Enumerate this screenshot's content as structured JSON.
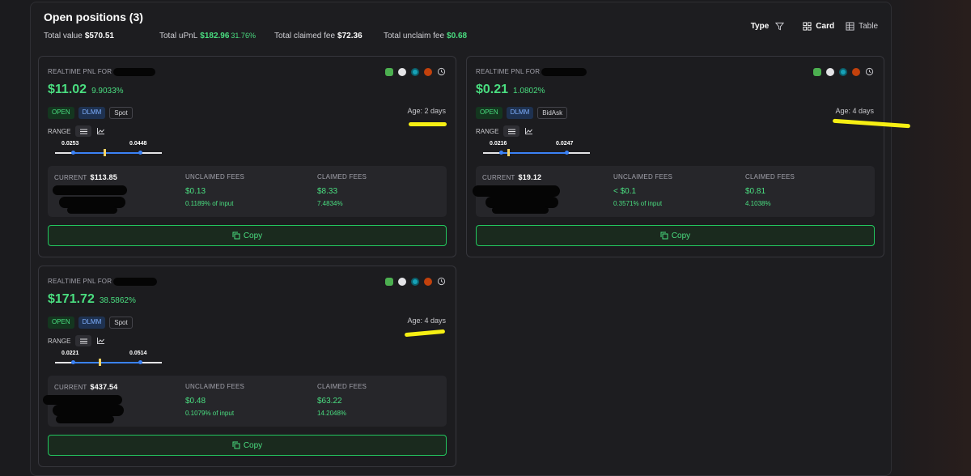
{
  "header": {
    "title": "Open positions (3)",
    "stats": {
      "total_value_label": "Total value",
      "total_value": "$570.51",
      "total_upnl_label": "Total uPnL",
      "total_upnl": "$182.96",
      "total_upnl_pct": "31.76%",
      "total_claimed_label": "Total claimed fee",
      "total_claimed": "$72.36",
      "total_unclaim_label": "Total unclaim fee",
      "total_unclaim": "$0.68"
    },
    "viewbar": {
      "type_label": "Type",
      "card_label": "Card",
      "table_label": "Table"
    }
  },
  "cards": [
    {
      "head": "REALTIME PNL FOR",
      "pnl_value": "$11.02",
      "pnl_pct": "9.9033%",
      "status": "OPEN",
      "pool": "DLMM",
      "strategy": "Spot",
      "age": "Age: 2 days",
      "range_label": "RANGE",
      "range_lo": "0.0253",
      "range_hi": "0.0448",
      "current_label": "CURRENT",
      "current_value": "$113.85",
      "unclaimed_label": "UNCLAIMED FEES",
      "unclaimed_value": "$0.13",
      "unclaimed_sub": "0.1189% of input",
      "claimed_label": "CLAIMED FEES",
      "claimed_value": "$8.33",
      "claimed_sub": "7.4834%",
      "copy_label": "Copy"
    },
    {
      "head": "REALTIME PNL FOR",
      "pnl_value": "$0.21",
      "pnl_pct": "1.0802%",
      "status": "OPEN",
      "pool": "DLMM",
      "strategy": "BidAsk",
      "age": "Age: 4 days",
      "range_label": "RANGE",
      "range_lo": "0.0216",
      "range_hi": "0.0247",
      "current_label": "CURRENT",
      "current_value": "$19.12",
      "unclaimed_label": "UNCLAIMED FEES",
      "unclaimed_value": "< $0.1",
      "unclaimed_sub": "0.3571% of input",
      "claimed_label": "CLAIMED FEES",
      "claimed_value": "$0.81",
      "claimed_sub": "4.1038%",
      "copy_label": "Copy"
    },
    {
      "head": "REALTIME PNL FOR",
      "pnl_value": "$171.72",
      "pnl_pct": "38.5862%",
      "status": "OPEN",
      "pool": "DLMM",
      "strategy": "Spot",
      "age": "Age: 4 days",
      "range_label": "RANGE",
      "range_lo": "0.0221",
      "range_hi": "0.0514",
      "current_label": "CURRENT",
      "current_value": "$437.54",
      "unclaimed_label": "UNCLAIMED FEES",
      "unclaimed_value": "$0.48",
      "unclaimed_sub": "0.1079% of input",
      "claimed_label": "CLAIMED FEES",
      "claimed_value": "$63.22",
      "claimed_sub": "14.2048%",
      "copy_label": "Copy"
    }
  ],
  "colors": {
    "accent_green": "#4ade80",
    "highlight_yellow": "#f6ef13",
    "dlmm_blue": "#3b82f6"
  },
  "icons": [
    "green-token-icon",
    "ghost-icon",
    "teal-ring-icon",
    "orange-token-icon",
    "history-icon",
    "filter-icon",
    "card-grid-icon",
    "table-icon",
    "list-icon",
    "line-chart-icon",
    "copy-icon"
  ]
}
